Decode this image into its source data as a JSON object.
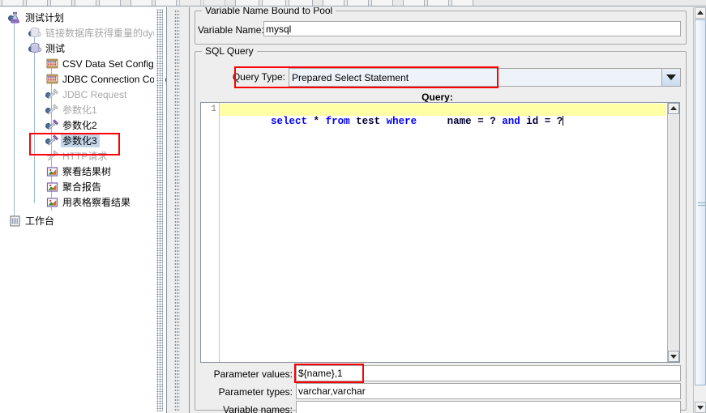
{
  "toolbar": {
    "buttons": [
      "new",
      "open",
      "save",
      "cut",
      "copy",
      "paste",
      "clear",
      "expand",
      "collapse",
      "toggle",
      "start",
      "start-no-pause",
      "stop",
      "shutdown",
      "clear-one",
      "clear-all",
      "search",
      "reset-search",
      "help"
    ]
  },
  "tree": {
    "items": [
      {
        "label": "测试计划",
        "icon": "flask-icon",
        "depth": 0,
        "state": "normal",
        "selected": false
      },
      {
        "label": "链接数据库获得重量的dynamic +",
        "icon": "thread-group-icon",
        "depth": 1,
        "state": "disabled",
        "selected": false
      },
      {
        "label": "测试",
        "icon": "thread-group-icon",
        "depth": 1,
        "state": "normal",
        "selected": false
      },
      {
        "label": "CSV Data Set Config",
        "icon": "config-icon",
        "depth": 2,
        "state": "normal",
        "selected": false
      },
      {
        "label": "JDBC Connection Configurat",
        "icon": "config-icon",
        "depth": 2,
        "state": "normal",
        "selected": false
      },
      {
        "label": "JDBC Request",
        "icon": "pipette-icon",
        "depth": 2,
        "state": "disabled",
        "selected": false
      },
      {
        "label": "参数化1",
        "icon": "pipette-icon",
        "depth": 2,
        "state": "disabled",
        "selected": false
      },
      {
        "label": "参数化2",
        "icon": "pipette-icon",
        "depth": 2,
        "state": "normal",
        "selected": false
      },
      {
        "label": "参数化3",
        "icon": "pipette-icon",
        "depth": 2,
        "state": "normal",
        "selected": true
      },
      {
        "label": "HTTP请求",
        "icon": "pipette-icon",
        "depth": 2,
        "state": "disabled",
        "selected": false
      },
      {
        "label": "察看结果树",
        "icon": "listener-icon",
        "depth": 2,
        "state": "normal",
        "selected": false
      },
      {
        "label": "聚合报告",
        "icon": "listener-icon",
        "depth": 2,
        "state": "normal",
        "selected": false
      },
      {
        "label": "用表格察看结果",
        "icon": "listener-icon",
        "depth": 2,
        "state": "normal",
        "selected": false
      },
      {
        "label": "工作台",
        "icon": "workbench-icon",
        "depth": 0,
        "state": "normal",
        "selected": false
      }
    ],
    "selection_highlight_color": "#ff0000"
  },
  "panel": {
    "variable_group_title": "Variable Name Bound to Pool",
    "variable_name_label": "Variable Name:",
    "variable_name_value": "mysql",
    "sql_group_title": "SQL Query",
    "query_type_label": "Query Type:",
    "query_type_value": "Prepared Select Statement",
    "query_label": "Query:",
    "editor": {
      "line_number": "1",
      "tokens": [
        {
          "text": "select",
          "type": "keyword"
        },
        {
          "text": " ",
          "type": "plain"
        },
        {
          "text": "*",
          "type": "ident"
        },
        {
          "text": " ",
          "type": "plain"
        },
        {
          "text": "from",
          "type": "keyword"
        },
        {
          "text": " ",
          "type": "plain"
        },
        {
          "text": "test",
          "type": "ident"
        },
        {
          "text": " ",
          "type": "plain"
        },
        {
          "text": "where",
          "type": "keyword"
        },
        {
          "text": "     ",
          "type": "plain"
        },
        {
          "text": "name",
          "type": "ident"
        },
        {
          "text": " = ",
          "type": "op"
        },
        {
          "text": "?",
          "type": "op"
        },
        {
          "text": " ",
          "type": "plain"
        },
        {
          "text": "and",
          "type": "keyword"
        },
        {
          "text": " ",
          "type": "plain"
        },
        {
          "text": "id",
          "type": "ident"
        },
        {
          "text": " = ",
          "type": "op"
        },
        {
          "text": "?",
          "type": "op"
        }
      ],
      "plain_text": "select * from test where     name = ? and id = ?"
    },
    "parameter_values_label": "Parameter values:",
    "parameter_values_value": "${name},1",
    "parameter_types_label": "Parameter types:",
    "parameter_types_value": "varchar,varchar",
    "variable_names_label": "Variable names:",
    "variable_names_value": ""
  },
  "colors": {
    "highlight_red": "#ff0000",
    "editor_line_bg": "#ffffa6",
    "keyword_blue": "#0000ff",
    "selection_blue": "#c3d5e8"
  }
}
